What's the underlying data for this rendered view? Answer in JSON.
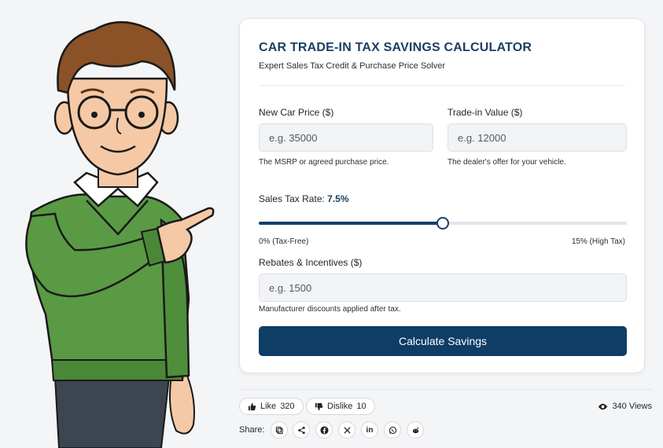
{
  "calculator": {
    "title": "CAR TRADE-IN TAX SAVINGS CALCULATOR",
    "subtitle": "Expert Sales Tax Credit & Purchase Price Solver",
    "new_price": {
      "label": "New Car Price ($)",
      "placeholder": "e.g. 35000",
      "value": "",
      "hint": "The MSRP or agreed purchase price."
    },
    "trade_in": {
      "label": "Trade-in Value ($)",
      "placeholder": "e.g. 12000",
      "value": "",
      "hint": "The dealer's offer for your vehicle."
    },
    "tax_rate": {
      "label": "Sales Tax Rate: ",
      "value_text": "7.5%",
      "value": 7.5,
      "min": 0,
      "max": 15,
      "min_label": "0% (Tax-Free)",
      "max_label": "15% (High Tax)"
    },
    "rebates": {
      "label": "Rebates & Incentives ($)",
      "placeholder": "e.g. 1500",
      "value": "",
      "hint": "Manufacturer discounts applied after tax."
    },
    "button_label": "Calculate Savings"
  },
  "engagement": {
    "like_label": "Like",
    "like_count": "320",
    "dislike_label": "Dislike",
    "dislike_count": "10",
    "views_text": "340 Views",
    "share_label": "Share:",
    "share_buttons": [
      "copy-link-icon",
      "share-icon",
      "facebook-icon",
      "x-icon",
      "linkedin-icon",
      "whatsapp-icon",
      "reddit-icon"
    ]
  },
  "colors": {
    "accent": "#0e3d66",
    "title": "#1d3f66",
    "sweater": "#5a9a44"
  }
}
